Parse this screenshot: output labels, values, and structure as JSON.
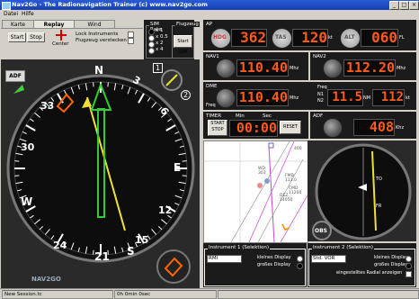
{
  "window": {
    "title": "Nav2Go - The Radionavigation Trainer (c) www.nav2go.com"
  },
  "menu": [
    "Datei",
    "Hilfe"
  ],
  "tabs": [
    "Karte",
    "Replay",
    "Wind"
  ],
  "controls": {
    "start": "Start",
    "stop": "Stop",
    "center": "Center",
    "lock_instruments": "Lock Instruments",
    "hide_aircraft": "Flugzeug verstecken",
    "sim_rate_label": "SIM Rate",
    "sim_rates": [
      "x 1",
      "x 0.5",
      "x 2",
      "x 4"
    ],
    "flugzeug_label": "Flugzeug",
    "start_sim": "Start SIM"
  },
  "ap": {
    "label": "AP",
    "hdg_label": "HDG",
    "hdg": "362",
    "tas_label": "TAS",
    "tas": "120",
    "tas_unit": "kt",
    "alt_label": "ALT",
    "alt": "060",
    "alt_unit": "FL"
  },
  "nav1": {
    "label": "NAV1",
    "freq": "110.40",
    "unit": "Mhz"
  },
  "nav2": {
    "label": "NAV2",
    "freq": "112.20",
    "unit": "Mhz"
  },
  "dme": {
    "label": "DME",
    "freq": "110.40",
    "unit": "Mhz",
    "freq_label": "Freq",
    "freq_sel": "Freq",
    "n1": "N1",
    "n2": "N2",
    "distance": "11.5",
    "dist_unit": "NM",
    "speed": "112",
    "speed_unit": "kt"
  },
  "timer": {
    "label": "TIMER",
    "start_stop": "START STOP",
    "min_label": "Min",
    "sec_label": "Sec",
    "value": "00:00",
    "reset": "RESET"
  },
  "adf": {
    "label": "ADF",
    "freq": "408",
    "unit": "Khz"
  },
  "rmi": {
    "adf_tag": "ADF",
    "brand": "NAV2GO",
    "num1": "1",
    "num2": "2",
    "card": [
      "N",
      "3",
      "6",
      "E",
      "12",
      "15",
      "S",
      "21",
      "24",
      "W",
      "30",
      "33"
    ]
  },
  "map_labels": {
    "wd": "WD\n303",
    "fmd": "FMD\n113.0",
    "cmd": "CMD\n11200",
    "dez": "DEZ\n14050",
    "num400": "400"
  },
  "vor": {
    "obs": "OBS",
    "to": "TO",
    "fr": "FR"
  },
  "instrument1": {
    "label": "Instrument 1 (Selektion)",
    "select": "RMI",
    "small": "kleines Display",
    "large": "großes Display"
  },
  "instrument2": {
    "label": "Instrument 2 (Selektion)",
    "select": "Std. VOR",
    "small": "kleines Display",
    "large": "großes Display",
    "radial": "eingestelltes Radial anzeigen"
  },
  "status": {
    "session": "New Session.tc",
    "time": "0h 0min 0sec"
  }
}
